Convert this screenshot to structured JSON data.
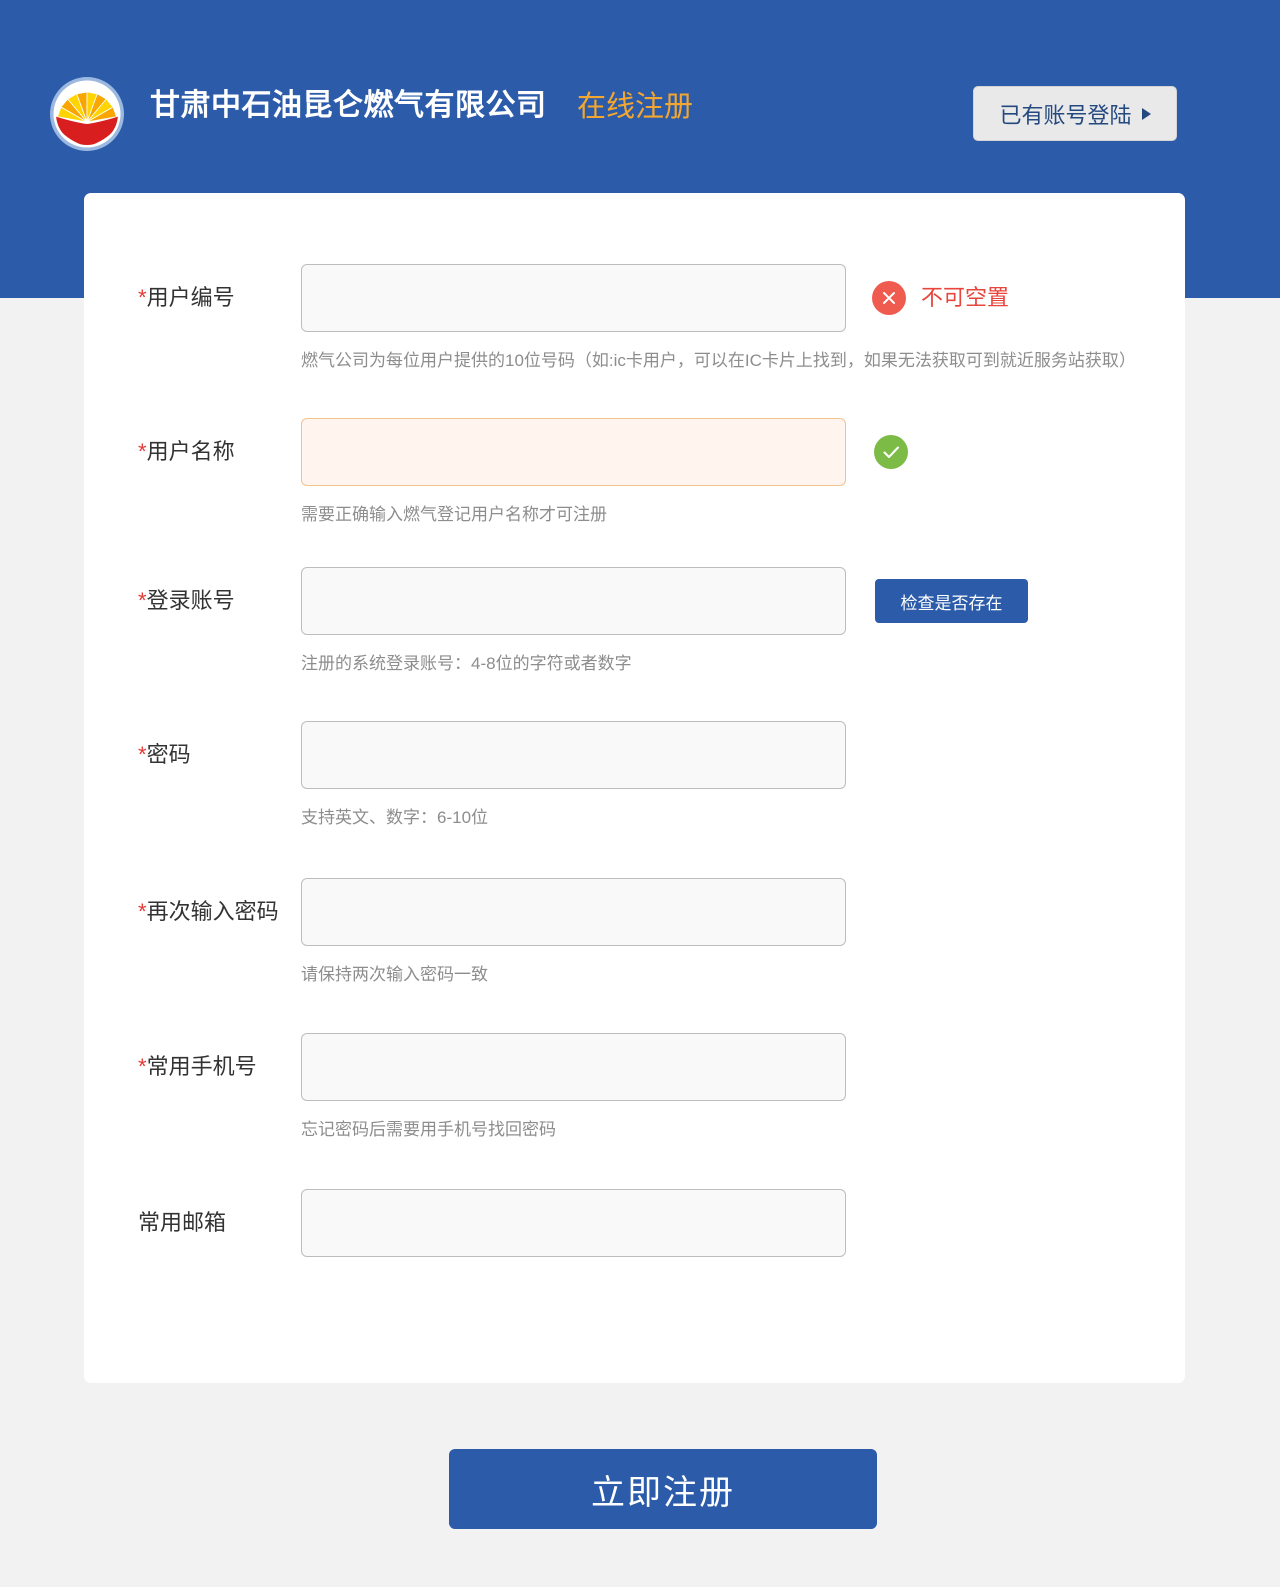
{
  "header": {
    "logo_icon": "petrochina-logo-icon",
    "company_name": "甘肃中石油昆仑燃气有限公司",
    "page_title": "在线注册",
    "login_link_label": "已有账号登陆",
    "login_link_icon": "caret-right-icon"
  },
  "form": {
    "required_mark": "*",
    "check_button_label": "检查是否存在",
    "fields": [
      {
        "label": "用户编号",
        "required": true,
        "value": "",
        "hint": "燃气公司为每位用户提供的10位号码（如:ic卡用户，可以在IC卡片上找到，如果无法获取可到就近服务站获取）",
        "status_icon": "error-icon",
        "message": "不可空置"
      },
      {
        "label": "用户名称",
        "required": true,
        "value": "",
        "hint": "需要正确输入燃气登记用户名称才可注册",
        "status_icon": "success-icon"
      },
      {
        "label": "登录账号",
        "required": true,
        "value": "",
        "hint": "注册的系统登录账号：4-8位的字符或者数字"
      },
      {
        "label": "密码",
        "required": true,
        "value": "",
        "hint": "支持英文、数字：6-10位"
      },
      {
        "label": "再次输入密码",
        "required": true,
        "value": "",
        "hint": "请保持两次输入密码一致"
      },
      {
        "label": "常用手机号",
        "required": true,
        "value": "",
        "hint": "忘记密码后需要用手机号找回密码"
      },
      {
        "label": "常用邮箱",
        "required": false,
        "value": ""
      }
    ]
  },
  "submit_label": "立即注册",
  "colors": {
    "brand_blue": "#2b5ba9",
    "accent_orange": "#f3a72f",
    "error_red": "#e8453c",
    "success_green": "#7dbb47",
    "page_background": "#f2f2f2"
  }
}
